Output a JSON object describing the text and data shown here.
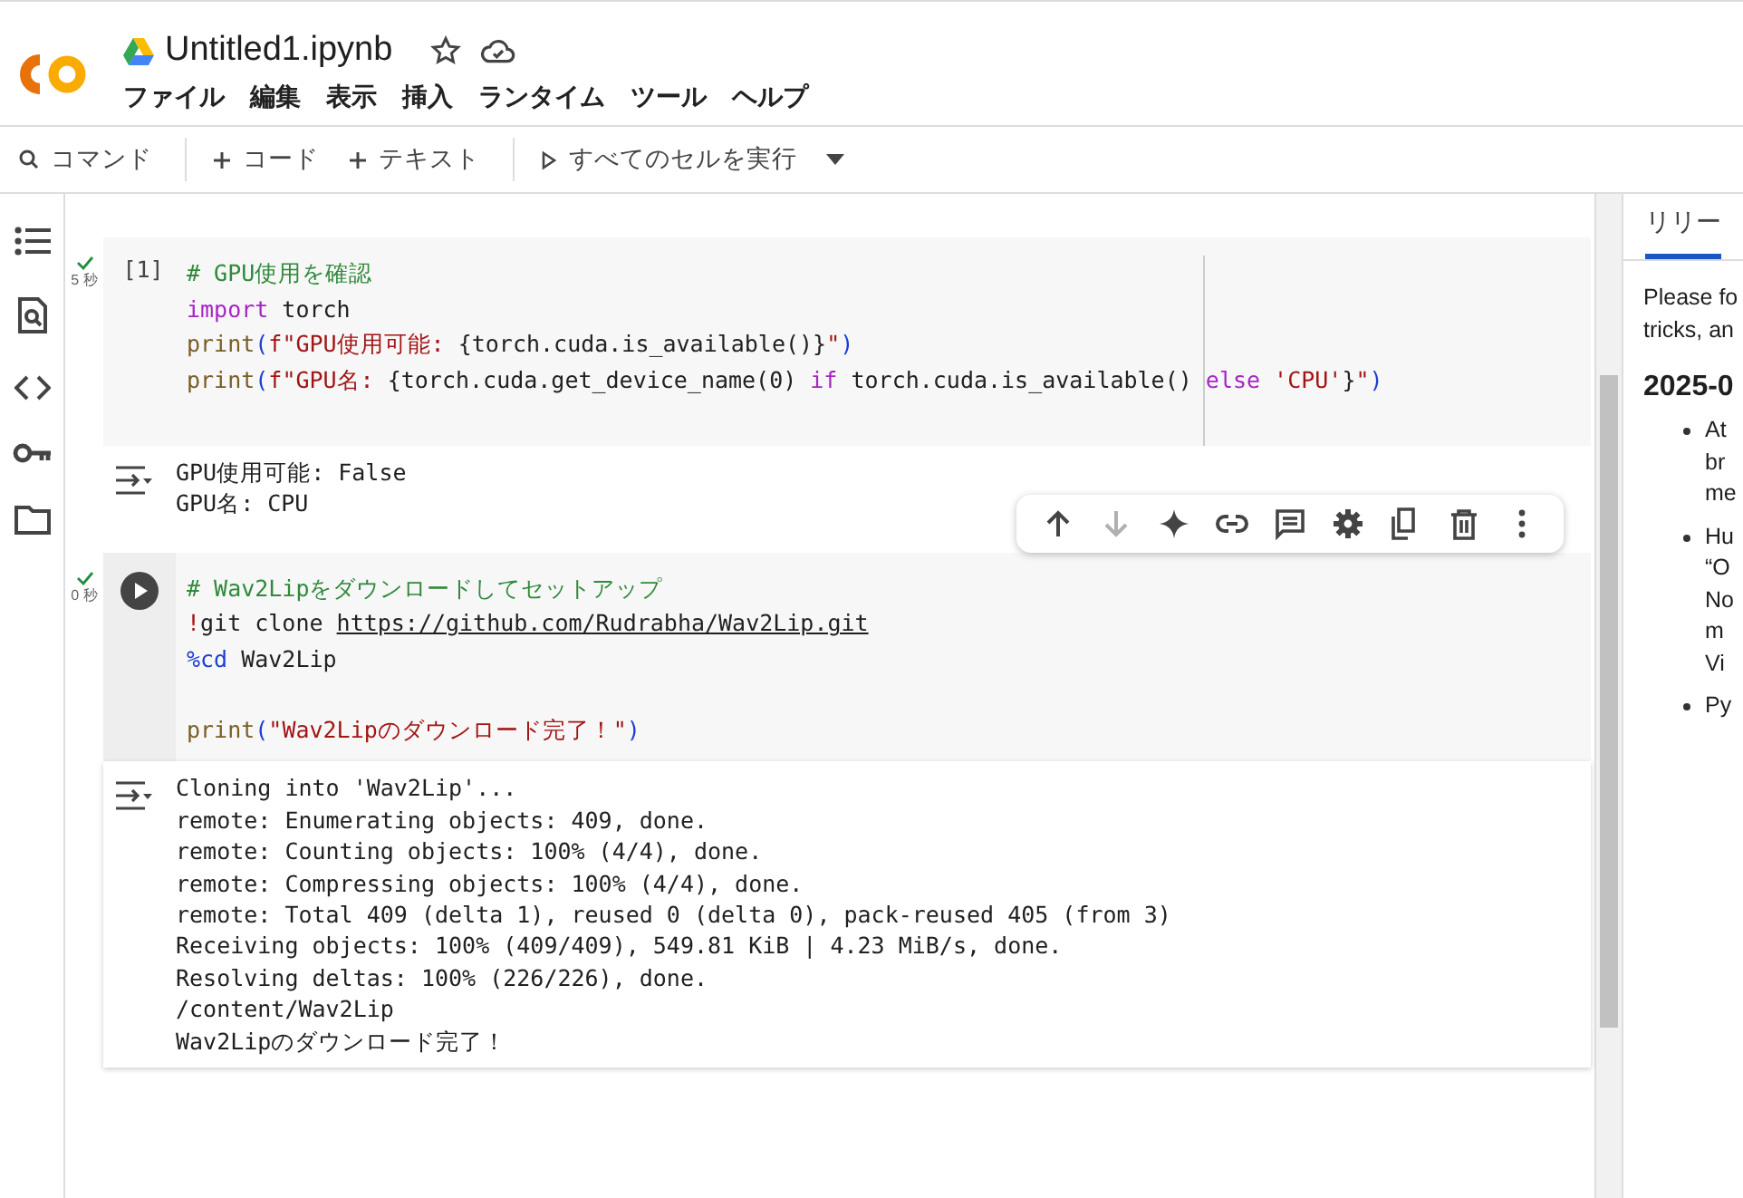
{
  "header": {
    "title": "Untitled1.ipynb",
    "starred": false,
    "menu": [
      "ファイル",
      "編集",
      "表示",
      "挿入",
      "ランタイム",
      "ツール",
      "ヘルプ"
    ]
  },
  "toolbar": {
    "search_label": "コマンド",
    "add_code": "コード",
    "add_text": "テキスト",
    "run_all": "すべてのセルを実行"
  },
  "cells": [
    {
      "focused": false,
      "count": "[1]",
      "time": "5 秒",
      "ruler": true,
      "lines": [
        [
          {
            "kind": "comment",
            "text": "# GPU使用を確認"
          }
        ],
        [
          {
            "kind": "keyword",
            "text": "import"
          },
          {
            "kind": "plain",
            "text": " torch"
          }
        ],
        [
          {
            "kind": "builtin",
            "text": "print"
          },
          {
            "kind": "paren",
            "text": "("
          },
          {
            "kind": "string",
            "text": "f\"GPU使用可能: "
          },
          {
            "kind": "plain",
            "text": "{torch.cuda.is_available()}"
          },
          {
            "kind": "string",
            "text": "\""
          },
          {
            "kind": "paren",
            "text": ")"
          }
        ],
        [
          {
            "kind": "builtin",
            "text": "print"
          },
          {
            "kind": "paren",
            "text": "("
          },
          {
            "kind": "string",
            "text": "f\"GPU名: "
          },
          {
            "kind": "plain",
            "text": "{torch.cuda.get_device_name(0) "
          },
          {
            "kind": "keyword",
            "text": "if"
          },
          {
            "kind": "plain",
            "text": " torch.cuda.is_available() "
          },
          {
            "kind": "keyword",
            "text": "else"
          },
          {
            "kind": "string",
            "text": " 'CPU'"
          },
          {
            "kind": "plain",
            "text": "}"
          },
          {
            "kind": "string",
            "text": "\""
          },
          {
            "kind": "paren",
            "text": ")"
          }
        ]
      ],
      "output": [
        "GPU使用可能: False",
        "GPU名: CPU"
      ]
    },
    {
      "focused": true,
      "time": "0 秒",
      "ruler": false,
      "lines": [
        [
          {
            "kind": "comment",
            "text": "# Wav2Lipをダウンロードしてセットアップ"
          }
        ],
        [
          {
            "kind": "string",
            "text": "!"
          },
          {
            "kind": "plain",
            "text": "git clone "
          },
          {
            "kind": "link",
            "text": "https://github.com/Rudrabha/Wav2Lip.git"
          }
        ],
        [
          {
            "kind": "magic",
            "text": "%cd"
          },
          {
            "kind": "plain",
            "text": " Wav2Lip"
          }
        ],
        [
          {
            "kind": "blank"
          }
        ],
        [
          {
            "kind": "builtin",
            "text": "print"
          },
          {
            "kind": "paren",
            "text": "("
          },
          {
            "kind": "string",
            "text": "\"Wav2Lipのダウンロード完了！\""
          },
          {
            "kind": "paren",
            "text": ")"
          }
        ]
      ],
      "output": [
        "Cloning into 'Wav2Lip'...",
        "remote: Enumerating objects: 409, done.",
        "remote: Counting objects: 100% (4/4), done.",
        "remote: Compressing objects: 100% (4/4), done.",
        "remote: Total 409 (delta 1), reused 0 (delta 0), pack-reused 405 (from 3)",
        "Receiving objects: 100% (409/409), 549.81 KiB | 4.23 MiB/s, done.",
        "Resolving deltas: 100% (226/226), done.",
        "/content/Wav2Lip",
        "Wav2Lipのダウンロード完了！"
      ]
    }
  ],
  "cell_toolbar": [
    {
      "kind": "up",
      "disabled": false
    },
    {
      "kind": "down",
      "disabled": true
    },
    {
      "kind": "sparkle",
      "disabled": false
    },
    {
      "kind": "link",
      "disabled": false
    },
    {
      "kind": "comment",
      "disabled": false
    },
    {
      "kind": "gear",
      "disabled": false
    },
    {
      "kind": "mirror",
      "disabled": false
    },
    {
      "kind": "trash",
      "disabled": false
    },
    {
      "kind": "more",
      "disabled": false
    }
  ],
  "side_panel": {
    "tabs": [
      {
        "label": "リリー",
        "selected": true
      }
    ],
    "intro": [
      "Please fo",
      "tricks, an"
    ],
    "heading": "2025-0",
    "bullets": [
      [
        "At",
        "br",
        "me"
      ],
      [
        "Hu",
        "“O",
        "No",
        "m",
        "Vi"
      ],
      [
        "Py"
      ]
    ]
  }
}
